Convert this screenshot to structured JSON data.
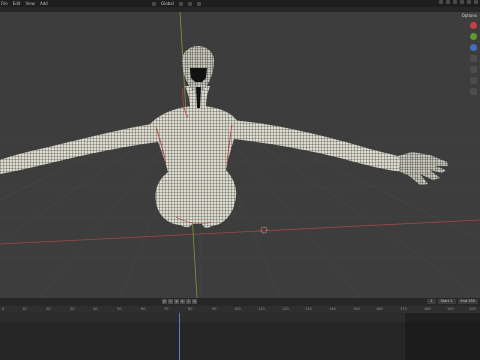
{
  "menu": {
    "items": [
      "File",
      "Edit",
      "View",
      "Add"
    ]
  },
  "header": {
    "orientation_label": "Global"
  },
  "viewport": {
    "shading_label": "Options"
  },
  "timeline": {
    "ruler_labels": [
      "0",
      "10",
      "20",
      "30",
      "40",
      "50",
      "60",
      "70",
      "80",
      "90",
      "100",
      "110",
      "120",
      "130",
      "140",
      "150",
      "160",
      "170",
      "180",
      "190",
      "200",
      "210",
      "220",
      "230",
      "240",
      "250"
    ],
    "start_label": "Start",
    "start_value": "1",
    "end_label": "End",
    "end_value": "250",
    "current_frame": "1"
  }
}
